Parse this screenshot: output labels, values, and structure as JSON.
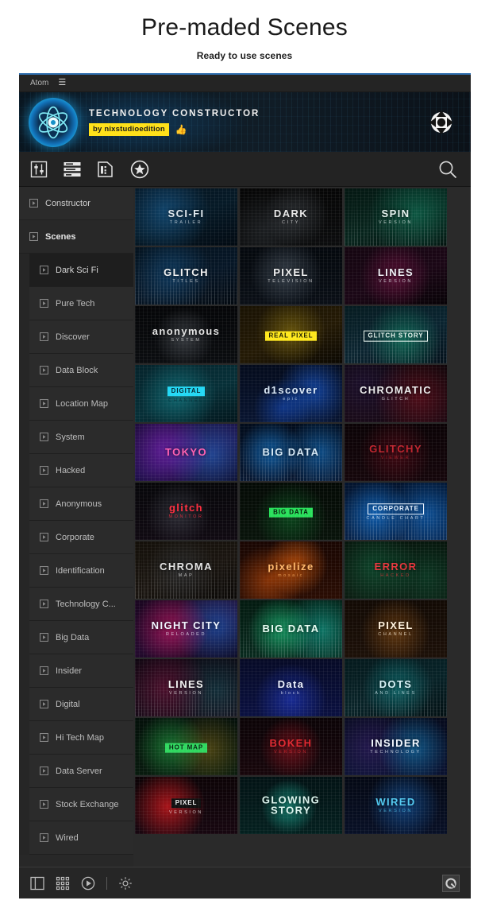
{
  "page": {
    "title": "Pre-maded Scenes",
    "subtitle": "Ready to use scenes"
  },
  "menubar": {
    "app_name": "Atom",
    "burger": "☰"
  },
  "banner": {
    "title": "TECHNOLOGY CONSTRUCTOR",
    "author_badge": "by nixstudioedition",
    "thumb_up": "👍",
    "logo_icon": "atom-icon",
    "gizmo_icon": "transform-gizmo-icon"
  },
  "toolbar": {
    "icons": [
      {
        "name": "sliders-icon"
      },
      {
        "name": "layers-list-icon"
      },
      {
        "name": "film-document-icon"
      },
      {
        "name": "star-circle-icon"
      }
    ],
    "search_icon": "search-icon"
  },
  "sidebar": {
    "top_items": [
      {
        "label": "Constructor",
        "bold": false
      },
      {
        "label": "Scenes",
        "bold": true
      }
    ],
    "scene_items": [
      {
        "label": "Dark Sci Fi",
        "active": true
      },
      {
        "label": "Pure Tech",
        "active": false
      },
      {
        "label": "Discover",
        "active": false
      },
      {
        "label": "Data Block",
        "active": false
      },
      {
        "label": "Location Map",
        "active": false
      },
      {
        "label": "System",
        "active": false
      },
      {
        "label": "Hacked",
        "active": false
      },
      {
        "label": "Anonymous",
        "active": false
      },
      {
        "label": "Corporate",
        "active": false
      },
      {
        "label": "Identification",
        "active": false
      },
      {
        "label": "Technology C...",
        "active": false
      },
      {
        "label": "Big Data",
        "active": false
      },
      {
        "label": "Insider",
        "active": false
      },
      {
        "label": "Digital",
        "active": false
      },
      {
        "label": "Hi Tech Map",
        "active": false
      },
      {
        "label": "Data Server",
        "active": false
      },
      {
        "label": "Stock Exchange",
        "active": false
      },
      {
        "label": "Wired",
        "active": false
      }
    ]
  },
  "scenes_grid": {
    "columns": 3,
    "cells": [
      {
        "title": "SCI-FI",
        "subtitle": "TRAILER",
        "color": "#dfe8ee",
        "bg": "sci-fi-blue-particles"
      },
      {
        "title": "DARK",
        "subtitle": "CITY",
        "color": "#e7e7e7",
        "bg": "dark-bokeh"
      },
      {
        "title": "SPIN",
        "subtitle": "VERSION",
        "color": "#e6f2ee",
        "bg": "green-data-columns"
      },
      {
        "title": "GLITCH",
        "subtitle": "TITLES",
        "color": "#f2f2f2",
        "bg": "glitch-magenta-bars"
      },
      {
        "title": "PIXEL",
        "subtitle": "TELEVISION",
        "color": "#f0f0f0",
        "bg": "pixel-white-noise"
      },
      {
        "title": "LINES",
        "subtitle": "VERSION",
        "color": "#eef0f5",
        "bg": "pink-line-grid"
      },
      {
        "title": "anonymous",
        "subtitle": "SYSTEM",
        "color": "#e2e2e2",
        "bg": "anonymous-mask"
      },
      {
        "title": "REAL PIXEL",
        "subtitle": "",
        "color": "#1a1a00",
        "bg": "yellow-glitch",
        "boxed": true,
        "box_bg": "#ffe81a"
      },
      {
        "title": "GLITCH STORY",
        "subtitle": "",
        "color": "#eaf6f0",
        "bg": "green-chart-glitch",
        "boxed": true,
        "box_bg": "rgba(0,0,0,0)"
      },
      {
        "title": "DIGITAL",
        "subtitle": "CHANNEL",
        "color": "#04252e",
        "bg": "teal-circuit",
        "boxed": true,
        "box_bg": "#22d8f5"
      },
      {
        "title": "d1scover",
        "subtitle": "epic",
        "color": "#dbe9f7",
        "bg": "blue-bokeh-circuit"
      },
      {
        "title": "CHROMATIC",
        "subtitle": "GLITCH",
        "color": "#ececec",
        "bg": "red-dark-grid"
      },
      {
        "title": "TOKYO",
        "subtitle": "",
        "color": "#ff5fb0",
        "bg": "purple-world-map"
      },
      {
        "title": "BIG DATA",
        "subtitle": "",
        "color": "#d6e8f5",
        "bg": "blue-candles-chart"
      },
      {
        "title": "GLITCHY",
        "subtitle": "VIEWER",
        "color": "#c2232d",
        "bg": "red-dot-field"
      },
      {
        "title": "glitch",
        "subtitle": "MONITOR",
        "color": "#ff2d3e",
        "bg": "glitch-skull"
      },
      {
        "title": "BIG DATA",
        "subtitle": "",
        "color": "#041a08",
        "bg": "green-matrix-map",
        "boxed": true,
        "box_bg": "#27e05a"
      },
      {
        "title": "CORPORATE",
        "subtitle": "CANDLE CHART",
        "color": "#e8f3ff",
        "bg": "blue-corporate-chart",
        "boxed": true,
        "box_bg": "rgba(0,0,0,0)"
      },
      {
        "title": "CHROMA",
        "subtitle": "MAP",
        "color": "#e2e2e2",
        "bg": "subway-map-lines"
      },
      {
        "title": "pixelize",
        "subtitle": "mosaic",
        "color": "#ffb86b",
        "bg": "orange-bokeh-circuit"
      },
      {
        "title": "ERROR",
        "subtitle": "HACKED",
        "color": "#e53238",
        "bg": "green-error-static"
      },
      {
        "title": "NIGHT CITY",
        "subtitle": "RELOADED",
        "color": "#f0f5ff",
        "bg": "pink-blue-world-map"
      },
      {
        "title": "BIG DATA",
        "subtitle": "",
        "color": "#e9fff4",
        "bg": "green-equalizer"
      },
      {
        "title": "PIXEL",
        "subtitle": "CHANNEL",
        "color": "#fff2dd",
        "bg": "orange-dot-grid"
      },
      {
        "title": "LINES",
        "subtitle": "VERSION",
        "color": "#f2f2f2",
        "bg": "pink-teal-lines"
      },
      {
        "title": "Data",
        "subtitle": "block",
        "color": "#eef3ff",
        "bg": "blue-deep-grid"
      },
      {
        "title": "DOTS",
        "subtitle": "AND LINES",
        "color": "#d9f3f7",
        "bg": "teal-dots-lines"
      },
      {
        "title": "HOT MAP",
        "subtitle": "",
        "color": "#04240f",
        "bg": "green-heat-map",
        "boxed": true,
        "box_bg": "#2fd85f"
      },
      {
        "title": "BOKEH",
        "subtitle": "VERSION",
        "color": "#e0272f",
        "bg": "red-bokeh-field"
      },
      {
        "title": "INSIDER",
        "subtitle": "TECHNOLOGY",
        "color": "#f4f9ff",
        "bg": "blue-radar-rings"
      },
      {
        "title": "PIXEL",
        "subtitle": "VERSION",
        "color": "#f2f2f2",
        "bg": "red-glow-pixels",
        "boxed": true,
        "box_bg": "#101010"
      },
      {
        "title": "GLOWING STORY",
        "subtitle": "",
        "color": "#dff7f0",
        "bg": "teal-hex-glow"
      },
      {
        "title": "WIRED",
        "subtitle": "VERSION",
        "color": "#4fc8f0",
        "bg": "blue-star-field"
      }
    ]
  },
  "bottombar": {
    "icons": [
      {
        "name": "panel-layout-icon"
      },
      {
        "name": "grid-dots-icon"
      },
      {
        "name": "play-circle-icon"
      },
      {
        "name": "gear-icon"
      }
    ],
    "brand_icon": "quixel-q-icon"
  }
}
